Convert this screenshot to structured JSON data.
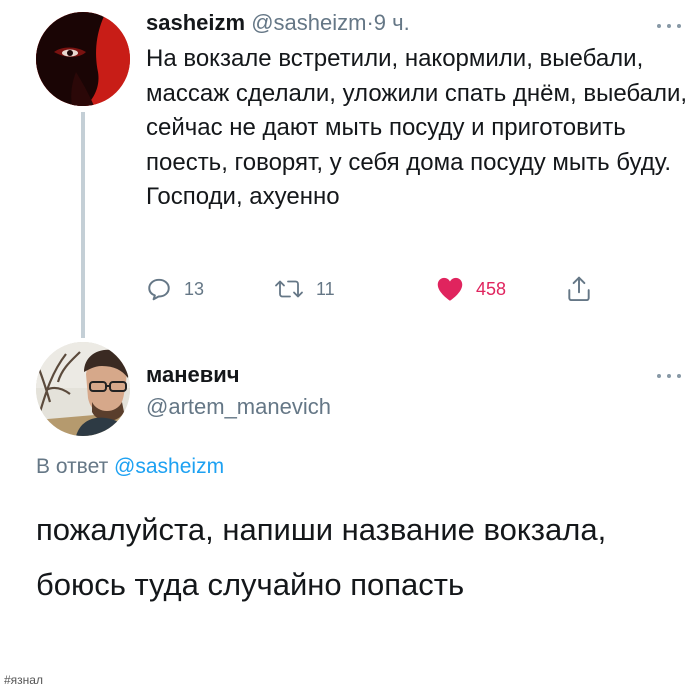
{
  "tweet": {
    "display_name": "sasheizm",
    "handle": "@sasheizm",
    "separator": "·",
    "time": "9 ч.",
    "text": "На вокзале встретили, накормили, выебали, массаж сделали, уложили спать днём, выебали, сейчас не дают мыть посуду и приготовить поесть, говорят, у себя дома посуду мыть буду. Господи, ахуенно",
    "avatar_icon": "avatar-red-portrait",
    "actions": {
      "reply_count": "13",
      "retweet_count": "11",
      "like_count": "458",
      "reply_icon": "reply-bubble-icon",
      "retweet_icon": "retweet-icon",
      "like_icon": "heart-icon",
      "share_icon": "share-icon"
    }
  },
  "reply": {
    "display_name": "маневич",
    "handle": "@artem_manevich",
    "in_reply_prefix": "В ответ",
    "in_reply_to": "@sasheizm",
    "text": "пожалуйста, напиши название вокзала, боюсь туда случайно попасть",
    "avatar_icon": "avatar-photo-portrait"
  },
  "watermark": "#язнал",
  "colors": {
    "text": "#14171a",
    "secondary": "#657786",
    "link": "#1da1f2",
    "like": "#e0245e",
    "thread_line": "#c4cfd6"
  }
}
